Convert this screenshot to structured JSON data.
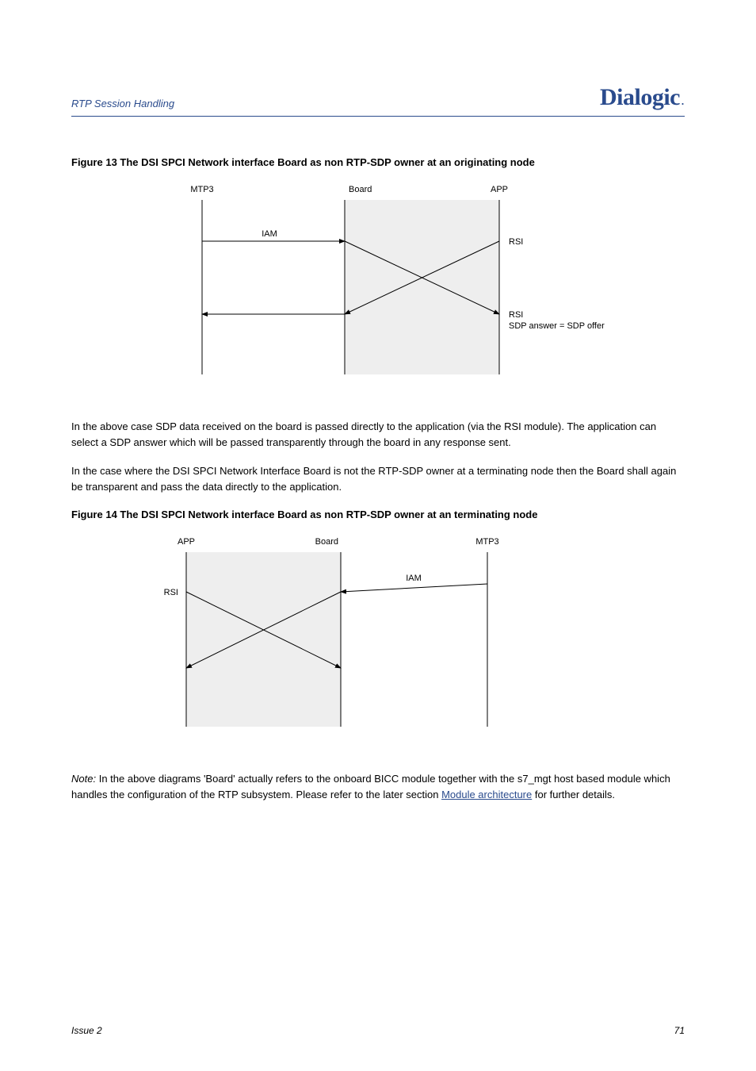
{
  "header": {
    "chapter": "RTP Session Handling",
    "logo": "Dialogic"
  },
  "figure13": {
    "caption": "Figure 13 The DSI SPCI Network interface Board as non RTP-SDP owner at an originating node",
    "labels": {
      "mtp3": "MTP3",
      "board": "Board",
      "app": "APP",
      "iam": "IAM",
      "rsi": "RSI",
      "sdp_offer": "SDP answer = SDP offer"
    }
  },
  "para1": "In the above case SDP data received on the board is passed directly to the application (via the RSI module). The application can select a SDP answer which will be passed transparently through the board in any response sent.",
  "para2": "In the case where the DSI SPCI Network Interface Board is not the RTP-SDP owner at a terminating node then the Board shall again be transparent and pass the data directly to the application.",
  "figure14": {
    "caption": "Figure 14 The DSI SPCI Network interface Board as non RTP-SDP owner at an terminating node",
    "labels": {
      "app": "APP",
      "board": "Board",
      "mtp3": "MTP3",
      "rsi": "RSI",
      "iam": "IAM"
    }
  },
  "note": {
    "label": "Note:",
    "text": "In the above diagrams 'Board' actually refers to the onboard BICC module together with the s7_mgt host based module which handles the configuration of the RTP subsystem. Please refer to the later section ",
    "link_text": "Module architecture",
    "after_link": " for further details."
  },
  "footer": {
    "left": "Issue 2",
    "right": "71"
  }
}
